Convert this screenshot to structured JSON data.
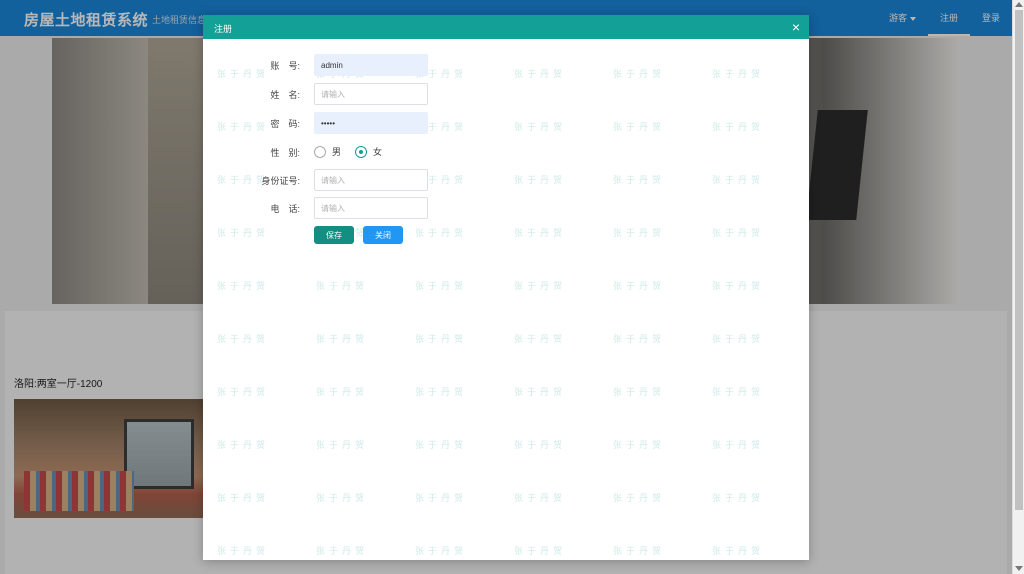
{
  "app": {
    "brand": "房屋土地租赁系统",
    "brand_sub": "土地租赁信息"
  },
  "nav": {
    "guest_label": "游客",
    "register_label": "注册",
    "login_label": "登录"
  },
  "listing": {
    "title": "洛阳:两室一厅-1200"
  },
  "modal": {
    "title": "注册",
    "close_symbol": "×",
    "watermark": "张于丹贺",
    "fields": {
      "account": {
        "label": "账　号:",
        "value": "admin",
        "placeholder": ""
      },
      "name": {
        "label": "姓　名:",
        "value": "",
        "placeholder": "请输入"
      },
      "password": {
        "label": "密　码:",
        "value": "•••••",
        "placeholder": ""
      },
      "gender": {
        "label": "性　别:",
        "options": [
          "男",
          "女"
        ],
        "selected": "女"
      },
      "id_card": {
        "label": "身份证号:",
        "value": "",
        "placeholder": "请输入"
      },
      "phone": {
        "label": "电　话:",
        "value": "",
        "placeholder": "请输入"
      }
    },
    "buttons": {
      "save": "保存",
      "close": "关闭"
    }
  },
  "colors": {
    "topbar": "#1a86d8",
    "modal_header": "#13a096",
    "save_button": "#148d82",
    "close_button": "#2196f3"
  }
}
